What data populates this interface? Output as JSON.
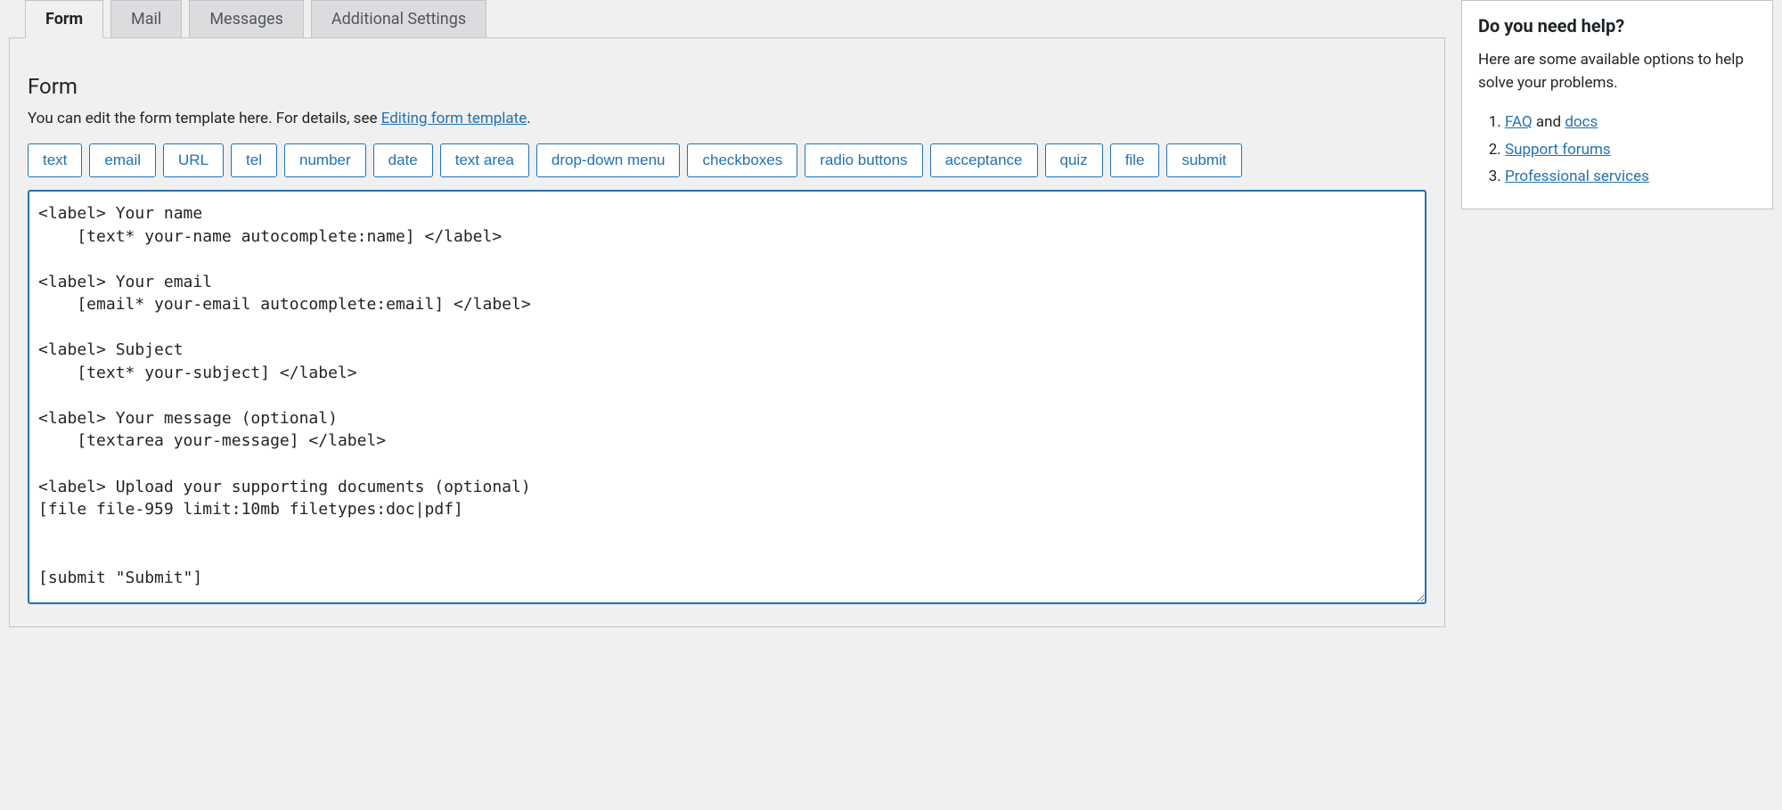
{
  "tabs": [
    {
      "label": "Form",
      "active": true
    },
    {
      "label": "Mail",
      "active": false
    },
    {
      "label": "Messages",
      "active": false
    },
    {
      "label": "Additional Settings",
      "active": false
    }
  ],
  "panel": {
    "heading": "Form",
    "intro_prefix": "You can edit the form template here. For details, see ",
    "intro_link": "Editing form template",
    "intro_suffix": "."
  },
  "tag_buttons": [
    "text",
    "email",
    "URL",
    "tel",
    "number",
    "date",
    "text area",
    "drop-down menu",
    "checkboxes",
    "radio buttons",
    "acceptance",
    "quiz",
    "file",
    "submit"
  ],
  "form_template": "<label> Your name\n    [text* your-name autocomplete:name] </label>\n\n<label> Your email\n    [email* your-email autocomplete:email] </label>\n\n<label> Subject\n    [text* your-subject] </label>\n\n<label> Your message (optional)\n    [textarea your-message] </label>\n\n<label> Upload your supporting documents (optional)\n[file file-959 limit:10mb filetypes:doc|pdf]\n\n\n[submit \"Submit\"]",
  "help": {
    "title": "Do you need help?",
    "intro": "Here are some available options to help solve your problems.",
    "items": [
      {
        "link1": "FAQ",
        "mid": " and ",
        "link2": "docs"
      },
      {
        "link1": "Support forums"
      },
      {
        "link1": "Professional services"
      }
    ]
  }
}
